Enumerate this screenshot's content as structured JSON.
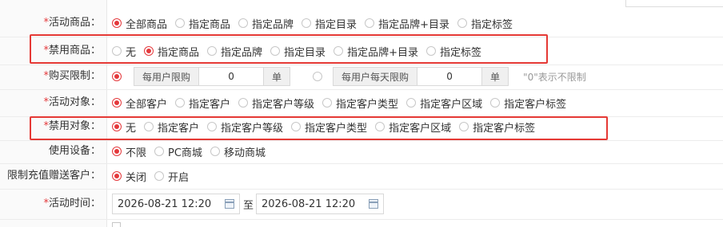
{
  "rows": {
    "activity_goods": {
      "label": "活动商品：",
      "required": "*",
      "options": [
        "全部商品",
        "指定商品",
        "指定品牌",
        "指定目录",
        "指定品牌+目录",
        "指定标签"
      ],
      "selected": 0
    },
    "excluded_goods": {
      "label": "禁用商品：",
      "required": "*",
      "options": [
        "无",
        "指定商品",
        "指定品牌",
        "指定目录",
        "指定品牌+目录",
        "指定标签"
      ],
      "selected": 1
    },
    "purchase_limit": {
      "label": "购买限制：",
      "required": "*",
      "per_user_label": "每用户限购",
      "per_user_value": "0",
      "per_user_unit": "单",
      "per_user_daily_label": "每用户每天限购",
      "per_user_daily_value": "0",
      "per_user_daily_unit": "单",
      "hint": "\"0\"表示不限制",
      "selected": 0
    },
    "activity_target": {
      "label": "活动对象：",
      "required": "*",
      "options": [
        "全部客户",
        "指定客户",
        "指定客户等级",
        "指定客户类型",
        "指定客户区域",
        "指定客户标签"
      ],
      "selected": 0
    },
    "excluded_target": {
      "label": "禁用对象：",
      "required": "*",
      "options": [
        "无",
        "指定客户",
        "指定客户等级",
        "指定客户类型",
        "指定客户区域",
        "指定客户标签"
      ],
      "selected": 0
    },
    "device": {
      "label": "使用设备：",
      "options": [
        "不限",
        "PC商城",
        "移动商城"
      ],
      "selected": 0
    },
    "recharge_limit": {
      "label": "限制充值赠送客户：",
      "options": [
        "关闭",
        "开启"
      ],
      "selected": 0
    },
    "activity_time": {
      "label": "活动时间：",
      "required": "*",
      "start": "2026-08-21 12:20",
      "to": "至",
      "end": "2026-08-21 12:20"
    }
  },
  "colors": {
    "accent": "#e4393c",
    "highlight_box": "#e53935"
  }
}
